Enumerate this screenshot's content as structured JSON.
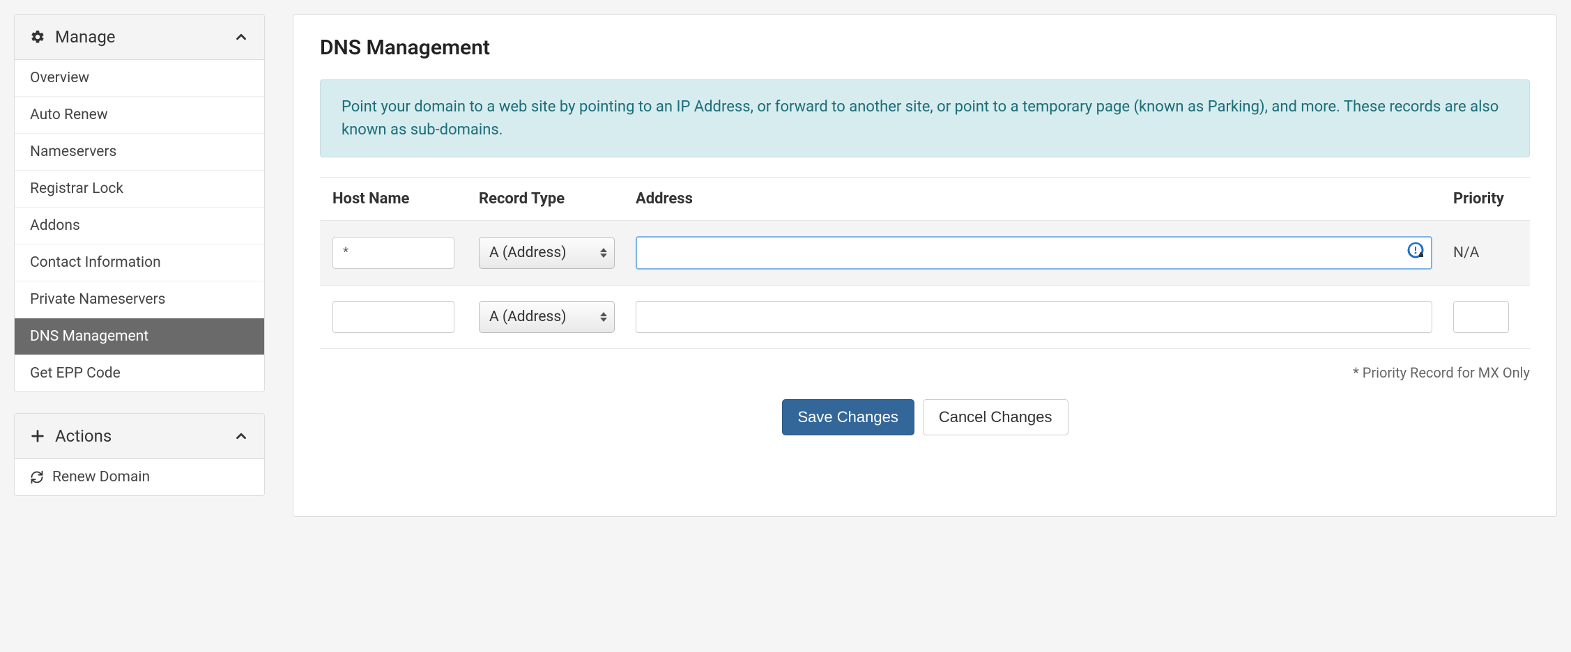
{
  "sidebar": {
    "manage": {
      "title": "Manage",
      "items": [
        {
          "label": "Overview"
        },
        {
          "label": "Auto Renew"
        },
        {
          "label": "Nameservers"
        },
        {
          "label": "Registrar Lock"
        },
        {
          "label": "Addons"
        },
        {
          "label": "Contact Information"
        },
        {
          "label": "Private Nameservers"
        },
        {
          "label": "DNS Management"
        },
        {
          "label": "Get EPP Code"
        }
      ],
      "active_index": 7
    },
    "actions": {
      "title": "Actions",
      "items": [
        {
          "label": "Renew Domain"
        }
      ]
    }
  },
  "main": {
    "title": "DNS Management",
    "info_text": "Point your domain to a web site by pointing to an IP Address, or forward to another site, or point to a temporary page (known as Parking), and more. These records are also known as sub-domains.",
    "columns": {
      "host": "Host Name",
      "type": "Record Type",
      "address": "Address",
      "priority": "Priority"
    },
    "rows": [
      {
        "host": "*",
        "type": "A (Address)",
        "address": "",
        "priority_na": "N/A",
        "focused": true,
        "highlighted": true
      },
      {
        "host": "",
        "type": "A (Address)",
        "address": "",
        "priority": ""
      }
    ],
    "note": "* Priority Record for MX Only",
    "buttons": {
      "save": "Save Changes",
      "cancel": "Cancel Changes"
    }
  }
}
